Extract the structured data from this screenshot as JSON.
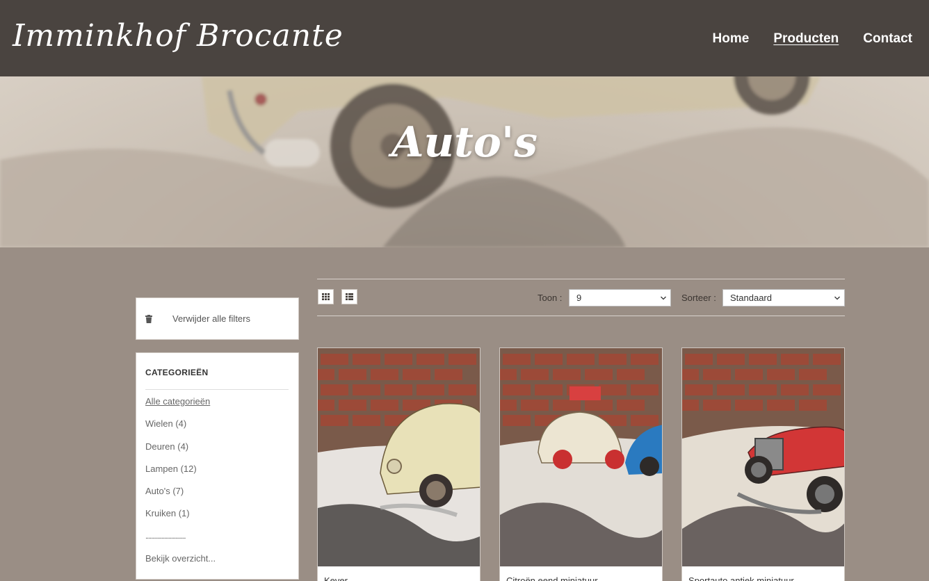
{
  "header": {
    "logo": "Imminkhof Brocante",
    "nav": [
      "Home",
      "Producten",
      "Contact"
    ],
    "active_nav": "Producten"
  },
  "hero": {
    "title": "Auto's"
  },
  "sidebar": {
    "clear_filters": "Verwijder alle filters",
    "categories_title": "CATEGORIEËN",
    "categories": [
      "Alle categorieën",
      "Wielen (4)",
      "Deuren (4)",
      "Lampen (12)",
      "Auto's (7)",
      "Kruiken (1)"
    ],
    "separator": "............................",
    "view_all": "Bekijk overzicht..."
  },
  "toolbar": {
    "show_label": "Toon :",
    "show_value": "9",
    "sort_label": "Sorteer :",
    "sort_value": "Standaard"
  },
  "products": [
    {
      "name": "Kever"
    },
    {
      "name": "Citroën eend miniatuur"
    },
    {
      "name": "Sportauto antiek miniatuur"
    }
  ],
  "colors": {
    "header_bg": "#4a4440",
    "page_bg": "#9a8e85",
    "panel_bg": "#ffffff"
  }
}
